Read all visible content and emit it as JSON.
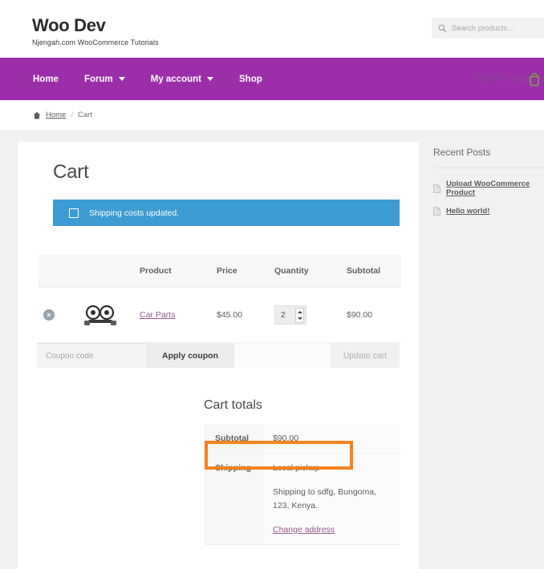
{
  "header": {
    "brand_title": "Woo Dev",
    "brand_tagline": "Njengah.com WooCommerce Tutorials",
    "search_placeholder": "Search products…",
    "search_value": "",
    "search_icon": "search-icon"
  },
  "nav": {
    "items": [
      {
        "label": "Home",
        "has_caret": false
      },
      {
        "label": "Forum",
        "has_caret": true
      },
      {
        "label": "My account",
        "has_caret": true
      },
      {
        "label": "Shop",
        "has_caret": false
      }
    ],
    "cart_total": "$90.00",
    "cart_count": "2 items",
    "cart_icon": "shopping-bag-icon",
    "bg_color": "#9c2eaa"
  },
  "breadcrumb": {
    "home_icon": "home-icon",
    "home_label": "Home",
    "separator": "/",
    "current": "Cart"
  },
  "main": {
    "page_title": "Cart",
    "notice": {
      "icon": "info-icon",
      "text": "Shipping costs updated.",
      "bg_color": "#3d9cd2"
    },
    "table": {
      "headers": [
        "",
        "",
        "Product",
        "Price",
        "Quantity",
        "Subtotal"
      ],
      "rows": [
        {
          "remove_label": "×",
          "thumbnail_icon": "car-parts-thumbnail",
          "product": "Car Parts",
          "price": "$45.00",
          "quantity": "2",
          "subtotal": "$90.00"
        }
      ]
    },
    "coupon": {
      "placeholder": "Coupon code",
      "value": "",
      "apply_label": "Apply coupon",
      "update_label": "Update cart"
    },
    "totals": {
      "title": "Cart totals",
      "subtotal_label": "Subtotal",
      "subtotal_value": "$90.00",
      "shipping_label": "Shipping",
      "shipping_value": "Local pickup",
      "shipping_note": "Shipping to sdfg, Bungoma, 123, Kenya.",
      "change_address_label": "Change address",
      "highlight_color": "#f58220"
    }
  },
  "sidebar": {
    "widget_title": "Recent Posts",
    "posts": [
      {
        "icon": "document-icon",
        "label": "Upload WooCommerce Product"
      },
      {
        "icon": "document-icon",
        "label": "Hello world!"
      }
    ]
  }
}
